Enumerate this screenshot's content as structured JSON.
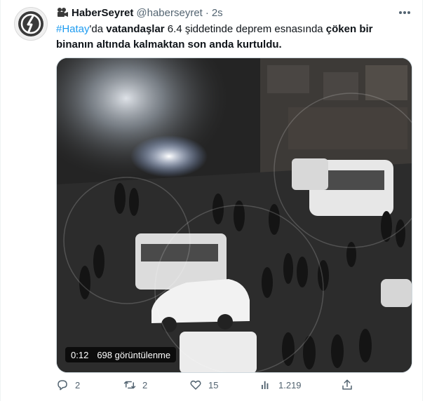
{
  "tweet": {
    "author": {
      "display_name": "HaberSeyret",
      "handle": "@haberseyret",
      "separator": "·",
      "time": "2s"
    },
    "text": {
      "hashtag": "#Hatay",
      "part1": "'da ",
      "bold1": "vatandaşlar",
      "part2": " 6.4 şiddetinde deprem esnasında ",
      "bold2": "çöken bir binanın altında kalmaktan son anda kurtuldu."
    },
    "media": {
      "duration": "0:12",
      "views": "698 görüntülenme"
    },
    "actions": {
      "replies": "2",
      "retweets": "2",
      "likes": "15",
      "views": "1.219"
    },
    "colors": {
      "accent": "#1d9bf0",
      "text": "#0f1419",
      "muted": "#536471"
    },
    "icons": [
      "camera-icon",
      "more-icon",
      "reply-icon",
      "retweet-icon",
      "like-icon",
      "views-icon",
      "share-icon"
    ]
  }
}
